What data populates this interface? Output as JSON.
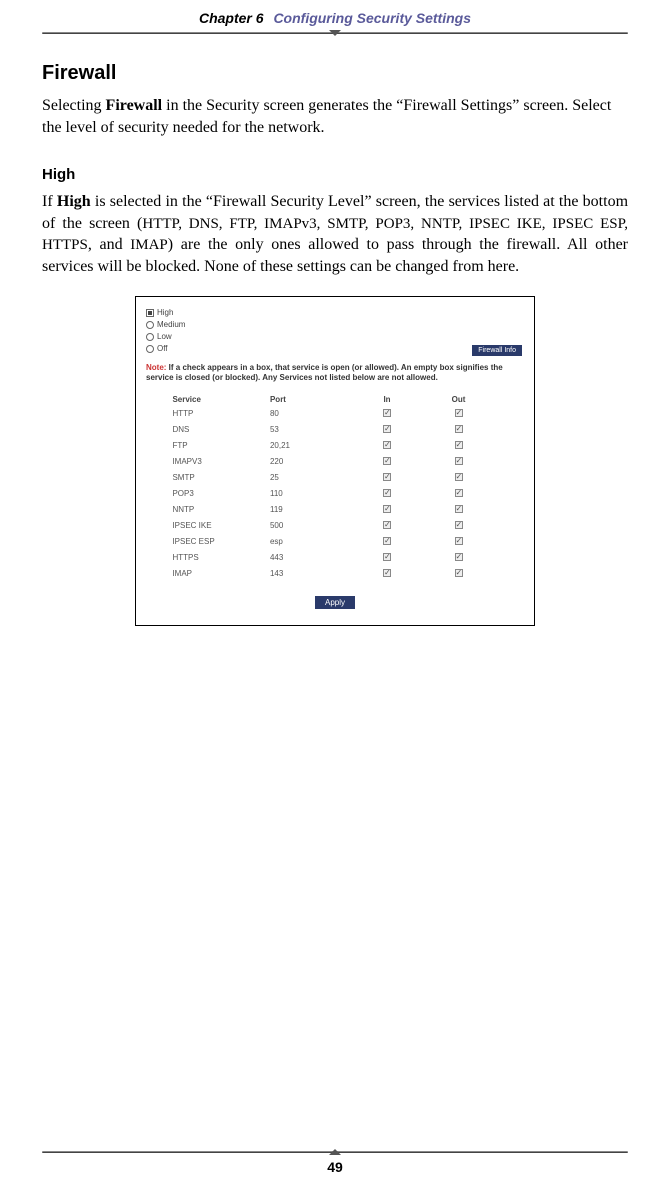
{
  "header": {
    "chapter": "Chapter 6",
    "title": "Configuring Security Settings"
  },
  "section": {
    "h1": "Firewall",
    "p1a": "Selecting ",
    "p1b": "Firewall",
    "p1c": " in the Security screen generates the “Firewall Settings” screen. Select the level of security needed for the network.",
    "h2": "High",
    "p2a": "If ",
    "p2b": "High",
    "p2c": " is selected in the “Firewall Security Level” screen, the services listed at the bottom of the screen (",
    "p2d": "HTTP, DNS, FTP, IMAPv3, SMTP, POP3, NNTP, IPSEC IKE, IPSEC ESP, HTTPS",
    "p2e": ", and ",
    "p2f": "IMAP",
    "p2g": ") are the only ones allowed to pass through the firewall. All other services will be blocked. None of these settings can be changed from here."
  },
  "screenshot": {
    "radios": [
      {
        "label": "High",
        "checked": true
      },
      {
        "label": "Medium",
        "checked": false
      },
      {
        "label": "Low",
        "checked": false
      },
      {
        "label": "Off",
        "checked": false
      }
    ],
    "firewall_info": "Firewall Info",
    "note_label": "Note:",
    "note_text": " If a check appears in a box, that service is open (or allowed). An empty box signifies the service is closed (or blocked). Any Services not listed below are not allowed.",
    "columns": {
      "service": "Service",
      "port": "Port",
      "in": "In",
      "out": "Out"
    },
    "rows": [
      {
        "service": "HTTP",
        "port": "80"
      },
      {
        "service": "DNS",
        "port": "53"
      },
      {
        "service": "FTP",
        "port": "20,21"
      },
      {
        "service": "IMAPV3",
        "port": "220"
      },
      {
        "service": "SMTP",
        "port": "25"
      },
      {
        "service": "POP3",
        "port": "110"
      },
      {
        "service": "NNTP",
        "port": "119"
      },
      {
        "service": "IPSEC IKE",
        "port": "500"
      },
      {
        "service": "IPSEC ESP",
        "port": "esp"
      },
      {
        "service": "HTTPS",
        "port": "443"
      },
      {
        "service": "IMAP",
        "port": "143"
      }
    ],
    "apply": "Apply"
  },
  "page_number": "49"
}
